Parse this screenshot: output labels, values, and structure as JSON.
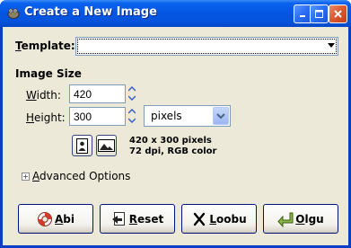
{
  "window": {
    "title": "Create a New Image",
    "controls": {
      "minimize": "minimize",
      "maximize": "maximize",
      "close": "close"
    }
  },
  "template": {
    "label_prefix": "T",
    "label_rest": "emplate:",
    "value": ""
  },
  "image_size": {
    "section_title": "Image Size",
    "width_label_u": "W",
    "width_label_rest": "idth:",
    "width_value": "420",
    "height_label_u": "H",
    "height_label_rest": "eight:",
    "height_value": "300",
    "unit": "pixels",
    "info_line1": "420 x 300 pixels",
    "info_line2": "72 dpi, RGB color"
  },
  "advanced": {
    "expander_symbol": "+",
    "label_u": "A",
    "label_rest": "dvanced Options"
  },
  "buttons": {
    "help_u": "A",
    "help_rest": "bi",
    "reset_u": "R",
    "reset_rest": "eset",
    "cancel_u": "L",
    "cancel_rest": "oobu",
    "ok_u": "O",
    "ok_rest": "lgu"
  },
  "colors": {
    "titlebar": "#0453dc",
    "face": "#ece9d8",
    "input_border": "#7f9db9"
  }
}
